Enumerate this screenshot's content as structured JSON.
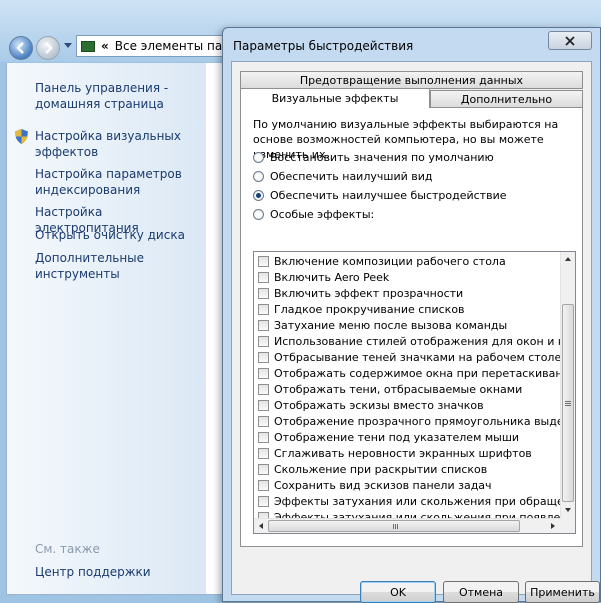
{
  "explorer": {
    "address_separator": "«",
    "address_text": "Все элементы пане",
    "sidebar": {
      "links": [
        {
          "label": "Панель управления - домашняя страница"
        },
        {
          "label": "Настройка визуальных эффектов"
        },
        {
          "label": "Настройка параметров индексирования"
        },
        {
          "label": "Настройка электропитания"
        },
        {
          "label": "Открыть очистку диска"
        },
        {
          "label": "Дополнительные инструменты"
        }
      ],
      "see_also_title": "См. также",
      "support_link": "Центр поддержки"
    }
  },
  "dialog": {
    "title": "Параметры быстродействия",
    "tabs": {
      "dep": "Предотвращение выполнения данных",
      "visual": "Визуальные эффекты",
      "advanced": "Дополнительно"
    },
    "description": "По умолчанию визуальные эффекты выбираются на основе возможностей компьютера, но вы можете изменить их.",
    "radios": [
      {
        "label": "Восстановить значения по умолчанию",
        "selected": false
      },
      {
        "label": "Обеспечить наилучший вид",
        "selected": false
      },
      {
        "label": "Обеспечить наилучшее быстродействие",
        "selected": true
      },
      {
        "label": "Особые эффекты:",
        "selected": false
      }
    ],
    "effects": [
      {
        "label": "Включение композиции рабочего стола",
        "checked": false
      },
      {
        "label": "Включить Aero Peek",
        "checked": false
      },
      {
        "label": "Включить эффект прозрачности",
        "checked": false
      },
      {
        "label": "Гладкое прокручивание списков",
        "checked": false
      },
      {
        "label": "Затухание меню после вызова команды",
        "checked": false
      },
      {
        "label": "Использование стилей отображения для окон и кнопок",
        "checked": false
      },
      {
        "label": "Отбрасывание теней значками на рабочем столе",
        "checked": false
      },
      {
        "label": "Отображать содержимое окна при перетаскивании",
        "checked": false
      },
      {
        "label": "Отображать тени, отбрасываемые окнами",
        "checked": false
      },
      {
        "label": "Отображать эскизы вместо значков",
        "checked": false
      },
      {
        "label": "Отображение прозрачного прямоугольника выделения",
        "checked": false
      },
      {
        "label": "Отображение тени под указателем мыши",
        "checked": false
      },
      {
        "label": "Сглаживать неровности экранных шрифтов",
        "checked": false
      },
      {
        "label": "Скольжение при раскрытии списков",
        "checked": false
      },
      {
        "label": "Сохранить вид эскизов панели задач",
        "checked": false
      },
      {
        "label": "Эффекты затухания или скольжения при обращении к",
        "checked": false
      },
      {
        "label": "Эффекты затухания или скольжения при появлении по",
        "checked": false
      }
    ],
    "buttons": {
      "ok": "OK",
      "cancel": "Отмена",
      "apply": "Применить"
    }
  }
}
